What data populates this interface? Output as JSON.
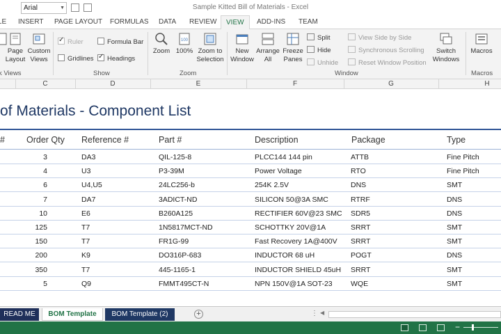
{
  "app": {
    "window_title": "Sample Kitted Bill of Materials - Excel",
    "font_name": "Arial"
  },
  "ribbon_tabs": [
    "FILE",
    "INSERT",
    "PAGE LAYOUT",
    "FORMULAS",
    "DATA",
    "REVIEW",
    "VIEW",
    "ADD-INS",
    "TEAM"
  ],
  "ribbon": {
    "workbook_views": {
      "label": "k Views",
      "page_layout": "Page Layout",
      "custom_views": "Custom Views"
    },
    "show": {
      "label": "Show",
      "ruler": "Ruler",
      "gridlines": "Gridlines",
      "formula_bar": "Formula Bar",
      "headings": "Headings"
    },
    "zoom": {
      "label": "Zoom",
      "zoom": "Zoom",
      "hundred": "100%",
      "to_selection": "Zoom to Selection"
    },
    "window": {
      "label": "Window",
      "new_window": "New Window",
      "arrange_all": "Arrange All",
      "freeze_panes": "Freeze Panes",
      "split": "Split",
      "hide": "Hide",
      "unhide": "Unhide",
      "side_by_side": "View Side by Side",
      "sync_scroll": "Synchronous Scrolling",
      "reset_position": "Reset Window Position",
      "switch_windows": "Switch Windows"
    },
    "macros": {
      "label": "Macros",
      "macros": "Macros"
    }
  },
  "column_headers": [
    "C",
    "D",
    "E",
    "F",
    "G",
    "H"
  ],
  "sheet": {
    "title": "of Materials - Component List",
    "headers": [
      "#",
      "Order Qty",
      "Reference #",
      "Part #",
      "Description",
      "Package",
      "Type"
    ],
    "rows": [
      {
        "qty": "3",
        "ref": "DA3",
        "part": "QIL-125-8",
        "desc": "PLCC144 144 pin",
        "pkg": "ATTB",
        "type": "Fine Pitch"
      },
      {
        "qty": "4",
        "ref": "U3",
        "part": "P3-39M",
        "desc": "Power Voltage",
        "pkg": "RTO",
        "type": "Fine Pitch"
      },
      {
        "qty": "6",
        "ref": "U4,U5",
        "part": "24LC256-b",
        "desc": "254K 2.5V",
        "pkg": "DNS",
        "type": "SMT"
      },
      {
        "qty": "7",
        "ref": "DA7",
        "part": "3ADICT-ND",
        "desc": "SILICON 50@3A SMC",
        "pkg": "RTRF",
        "type": "DNS"
      },
      {
        "qty": "10",
        "ref": "E6",
        "part": "B260A125",
        "desc": "RECTIFIER 60V@23 SMC",
        "pkg": "SDR5",
        "type": "DNS"
      },
      {
        "qty": "125",
        "ref": "T7",
        "part": "1N5817MCT-ND",
        "desc": "SCHOTTKY 20V@1A",
        "pkg": "SRRT",
        "type": "SMT"
      },
      {
        "qty": "150",
        "ref": "T7",
        "part": "FR1G-99",
        "desc": "Fast Recovery 1A@400V",
        "pkg": "SRRT",
        "type": "SMT"
      },
      {
        "qty": "200",
        "ref": "K9",
        "part": "DO316P-683",
        "desc": "INDUCTOR 68 uH",
        "pkg": "POGT",
        "type": "DNS"
      },
      {
        "qty": "350",
        "ref": "T7",
        "part": "445-1165-1",
        "desc": "INDUCTOR SHIELD 45uH",
        "pkg": "SRRT",
        "type": "SMT"
      },
      {
        "qty": "5",
        "ref": "Q9",
        "part": "FMMT495CT-N",
        "desc": "NPN 150V@1A SOT-23",
        "pkg": "WQE",
        "type": "SMT"
      }
    ]
  },
  "sheet_tabs": [
    "READ ME",
    "BOM Template",
    "BOM Template (2)"
  ],
  "colors": {
    "excel_green": "#217346",
    "title_blue": "#1f3864",
    "header_rule": "#2f5597"
  }
}
